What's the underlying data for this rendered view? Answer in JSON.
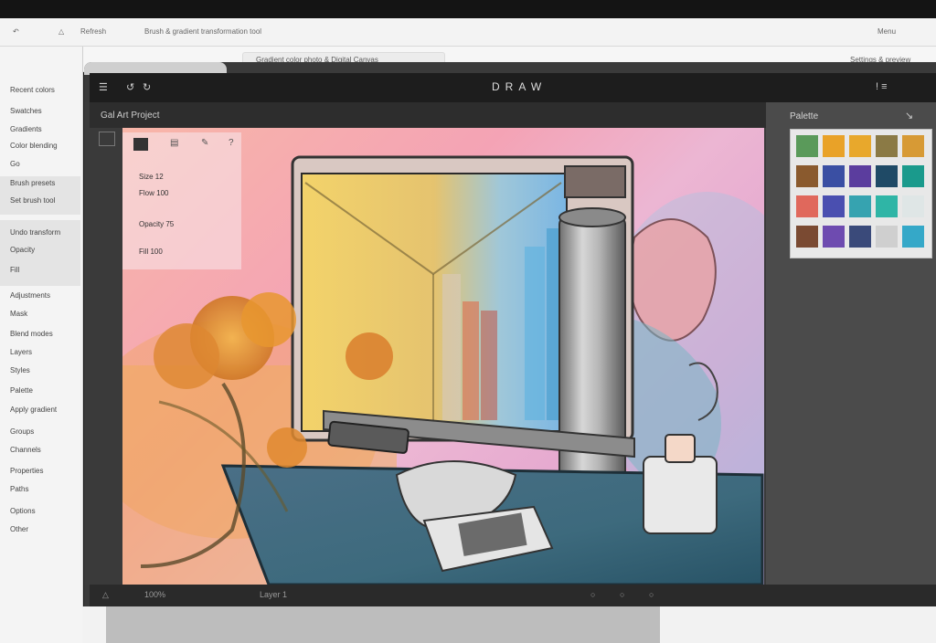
{
  "toolbar": {
    "a": "Refresh",
    "b": "Brush & gradient transformation tool",
    "right": "Menu"
  },
  "subbar": {
    "tab": "Gradient color photo & Digital Canvas",
    "right": "Settings & preview"
  },
  "sidebar": {
    "items": [
      "Recent colors",
      "Swatches",
      "Gradients",
      "Color blending",
      "Go",
      "Brush presets",
      "Set brush tool",
      "Undo transform",
      "Opacity",
      "Fill",
      "Adjustments",
      "Mask",
      "Blend modes",
      "Layers",
      "Styles",
      "Palette",
      "Apply gradient",
      "Groups",
      "Channels",
      "Properties",
      "Paths",
      "Options",
      "Other"
    ]
  },
  "app": {
    "title": "Gal Art Project",
    "toolbar_center": "DRAW",
    "right_icons": "! ≡"
  },
  "floatpanel": {
    "rows": [
      "Size 12",
      "Flow 100",
      "Opacity 75",
      "Fill 100"
    ]
  },
  "rightpanel": {
    "header": "Palette",
    "swatches": [
      "#5a9a5a",
      "#e9a228",
      "#e8a82c",
      "#8b7a45",
      "#d79a35",
      "#8a5a2e",
      "#3a4fa3",
      "#5b3d9e",
      "#1f4a66",
      "#1a9a8c",
      "#e0685c",
      "#4a4fb0",
      "#36a3b0",
      "#2fb5a6",
      "#dfe6e6",
      "#7a4a32",
      "#6e4bb0",
      "#3a4a7a",
      "#cfcfcf",
      "#35a8c8"
    ]
  },
  "status": {
    "zoom": "100%",
    "info": "Layer 1"
  },
  "icons": {
    "menu": "menu-icon",
    "undo": "undo-icon",
    "brush": "brush-icon",
    "eyedropper": "eyedropper-icon"
  }
}
